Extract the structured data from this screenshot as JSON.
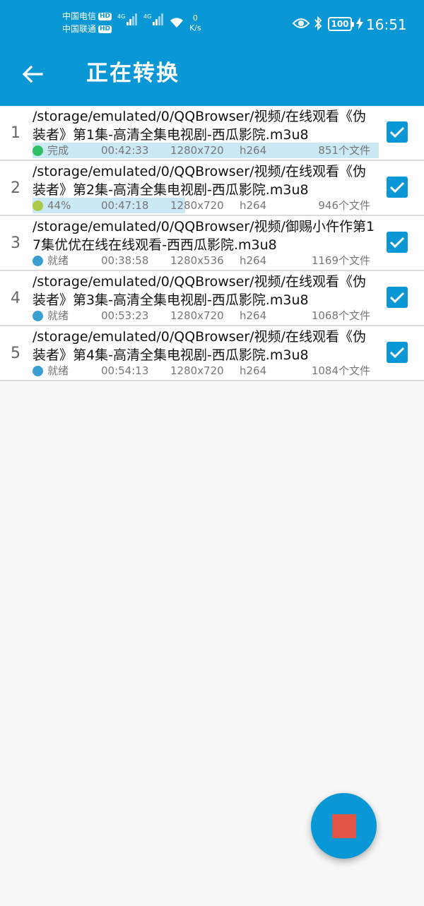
{
  "status_bar": {
    "carrier1": "中国电信",
    "carrier2": "中国联通",
    "hd": "HD",
    "net1": "4G",
    "net2": "4G",
    "speed_value": "0",
    "speed_unit": "K/s",
    "battery": "100",
    "time": "16:51"
  },
  "toolbar": {
    "title": "正在转换",
    "back_icon": "arrow-back-icon"
  },
  "colors": {
    "primary": "#0a97d6",
    "progress": "#cbe8f5",
    "done": "#2fbf62",
    "converting": "#a8c94a",
    "ready": "#3a9fd0",
    "stop": "#e05544"
  },
  "items": [
    {
      "index": "1",
      "path": "/storage/emulated/0/QQBrowser/视频/在线观看《伪装者》第1集-高清全集电视剧-西瓜影院.m3u8",
      "status": "完成",
      "status_color": "#2fbf62",
      "progress": 1.0,
      "duration": "00:42:33",
      "resolution": "1280x720",
      "codec": "h264",
      "files": "851个文件",
      "checked": true
    },
    {
      "index": "2",
      "path": "/storage/emulated/0/QQBrowser/视频/在线观看《伪装者》第2集-高清全集电视剧-西瓜影院.m3u8",
      "status": "44%",
      "status_color": "#a8c94a",
      "progress": 0.44,
      "duration": "00:47:18",
      "resolution": "1280x720",
      "codec": "h264",
      "files": "946个文件",
      "checked": true
    },
    {
      "index": "3",
      "path": "/storage/emulated/0/QQBrowser/视频/御赐小仵作第17集优优在线在线观看-西西瓜影院.m3u8",
      "status": "就绪",
      "status_color": "#3a9fd0",
      "progress": 0,
      "duration": "00:38:58",
      "resolution": "1280x536",
      "codec": "h264",
      "files": "1169个文件",
      "checked": true
    },
    {
      "index": "4",
      "path": "/storage/emulated/0/QQBrowser/视频/在线观看《伪装者》第3集-高清全集电视剧-西瓜影院.m3u8",
      "status": "就绪",
      "status_color": "#3a9fd0",
      "progress": 0,
      "duration": "00:53:23",
      "resolution": "1280x720",
      "codec": "h264",
      "files": "1068个文件",
      "checked": true
    },
    {
      "index": "5",
      "path": "/storage/emulated/0/QQBrowser/视频/在线观看《伪装者》第4集-高清全集电视剧-西瓜影院.m3u8",
      "status": "就绪",
      "status_color": "#3a9fd0",
      "progress": 0,
      "duration": "00:54:13",
      "resolution": "1280x720",
      "codec": "h264",
      "files": "1084个文件",
      "checked": true
    }
  ],
  "fab": {
    "icon": "stop-icon"
  }
}
